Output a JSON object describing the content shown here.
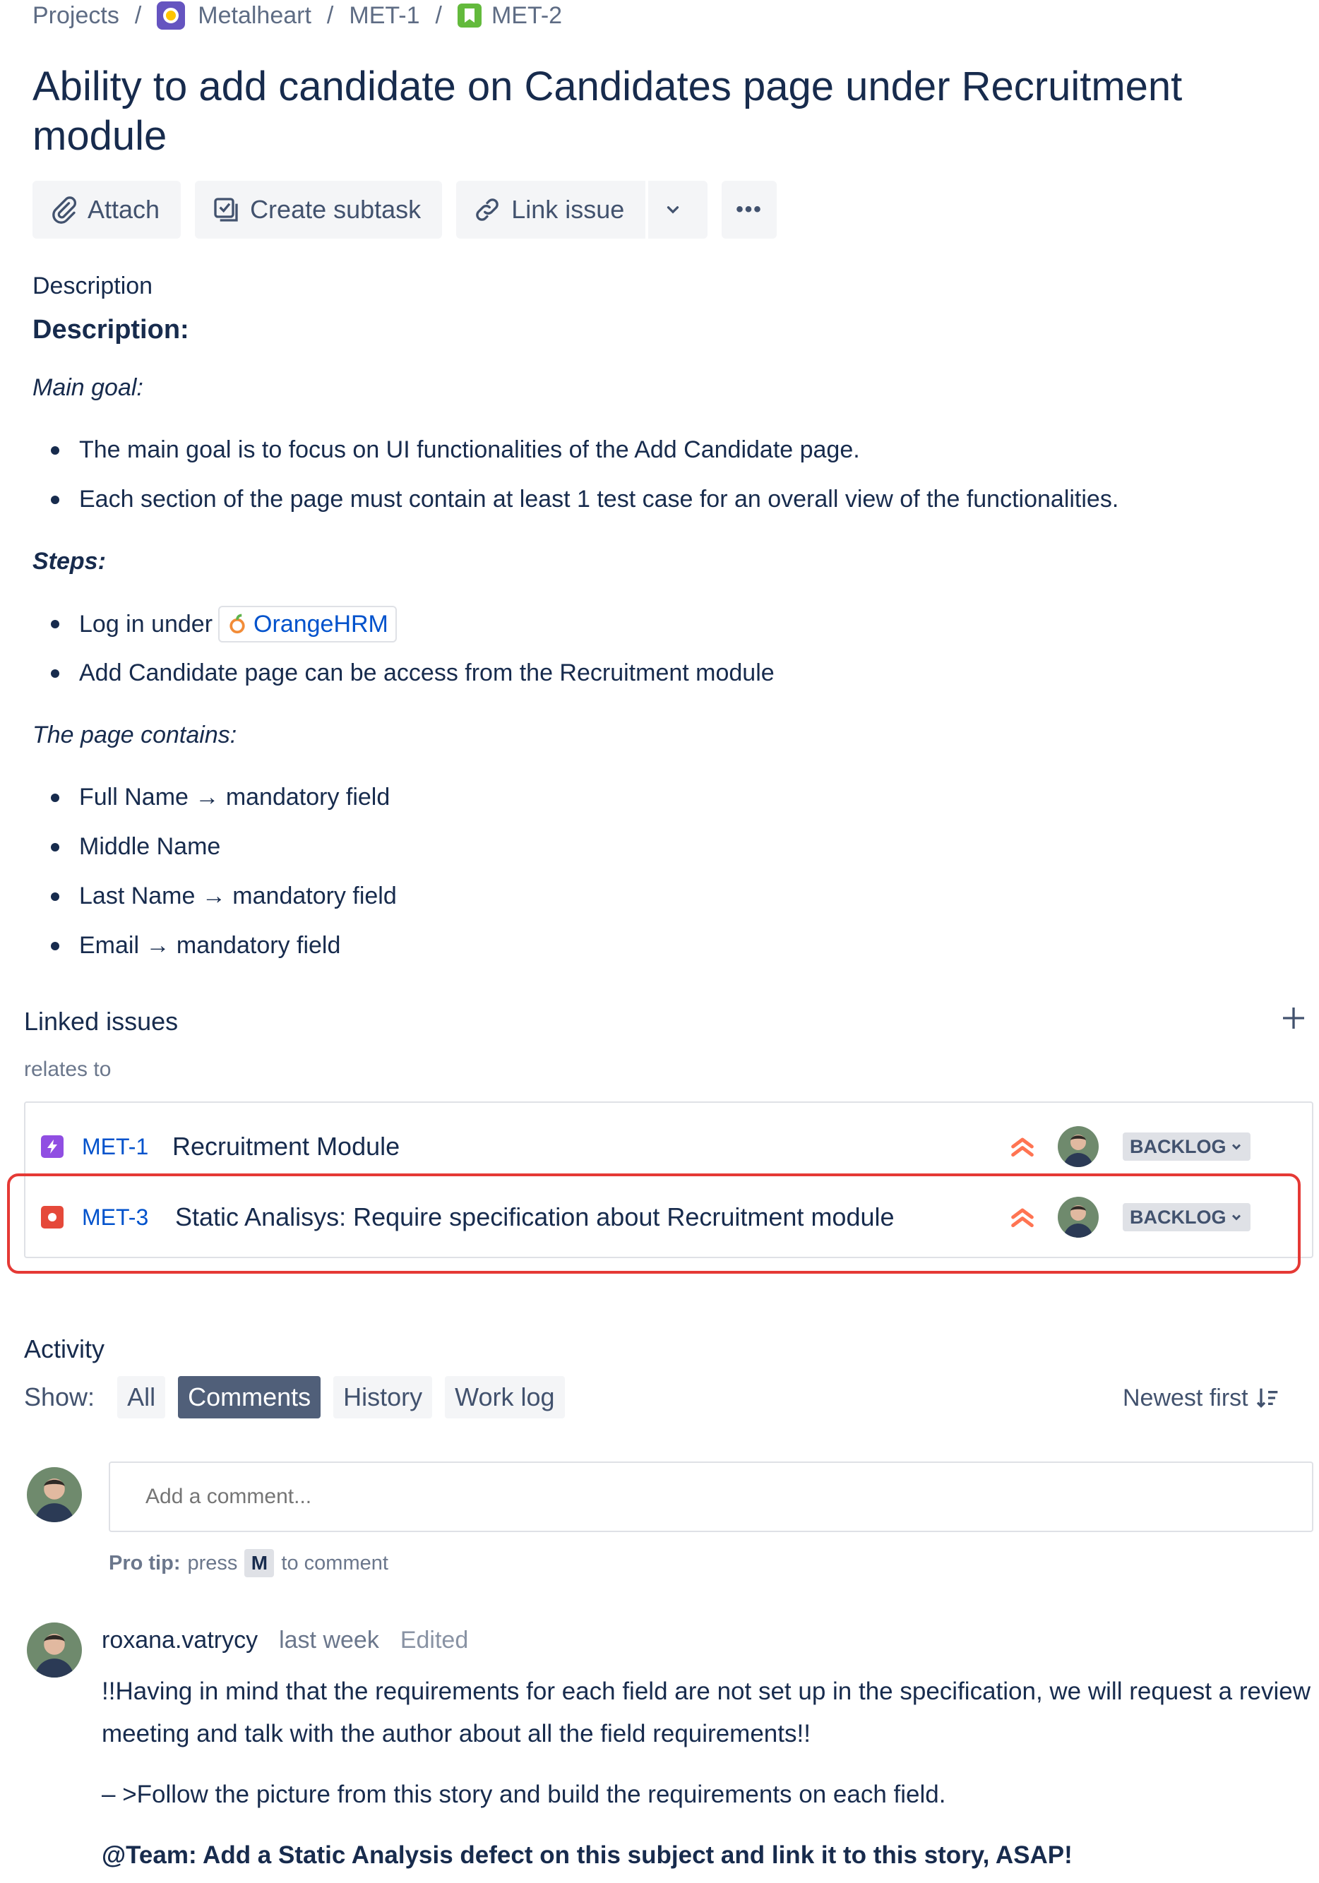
{
  "breadcrumb": {
    "projects": "Projects",
    "project": "Metalheart",
    "parent": "MET-1",
    "current": "MET-2",
    "separator": "/"
  },
  "issue": {
    "title": "Ability to add candidate on Candidates page under Recruitment module"
  },
  "toolbar": {
    "attach": "Attach",
    "create_subtask": "Create subtask",
    "link_issue": "Link issue",
    "more": "•••"
  },
  "description": {
    "label": "Description",
    "heading": "Description:",
    "main_goal": "Main goal:",
    "goal_items": [
      "The main goal is to focus on UI functionalities of the Add Candidate page.",
      "Each section of the page must contain at least 1 test case for an overall view of the functionalities."
    ],
    "steps": "Steps:",
    "step1_prefix": "Log in under",
    "step1_link": "OrangeHRM",
    "step2": "Add Candidate page can be access from the Recruitment module",
    "contains": "The page contains:",
    "fields": [
      "Full Name → mandatory field",
      "Middle Name",
      "Last Name → mandatory field",
      "Email → mandatory field"
    ]
  },
  "linked_issues": {
    "title": "Linked issues",
    "relation": "relates to",
    "items": [
      {
        "key": "MET-1",
        "type_icon": "epic-icon",
        "type_color": "#904ee2",
        "summary": "Recruitment Module",
        "priority": "high-priority-icon",
        "status": "BACKLOG"
      },
      {
        "key": "MET-3",
        "type_icon": "bug-icon",
        "type_color": "#e5493a",
        "summary": "Static Analisys: Require specification about Recruitment module",
        "priority": "high-priority-icon",
        "status": "BACKLOG"
      }
    ]
  },
  "activity": {
    "title": "Activity",
    "show_label": "Show:",
    "filters": [
      "All",
      "Comments",
      "History",
      "Work log"
    ],
    "active_filter": "Comments",
    "sort": "Newest first",
    "comment_placeholder": "Add a comment...",
    "protip_bold": "Pro tip:",
    "protip_press": "press",
    "protip_key": "M",
    "protip_suffix": "to comment"
  },
  "comment": {
    "author": "roxana.vatrycy",
    "time": "last week",
    "edited": "Edited",
    "line1": "!!Having in mind that the requirements for each field are not set up in the specification, we will request a review",
    "line2": "meeting and talk with the author about all the field requirements!!",
    "line3": "– >Follow the picture from this story and build the requirements on each field.",
    "line4": "@Team: Add a Static Analysis defect on this subject and link it to this story, ASAP!"
  },
  "colors": {
    "text": "#172b4d",
    "link": "#0052cc",
    "highlight": "#e53935",
    "priority": "#ff7452",
    "active_filter_bg": "#505f79"
  }
}
